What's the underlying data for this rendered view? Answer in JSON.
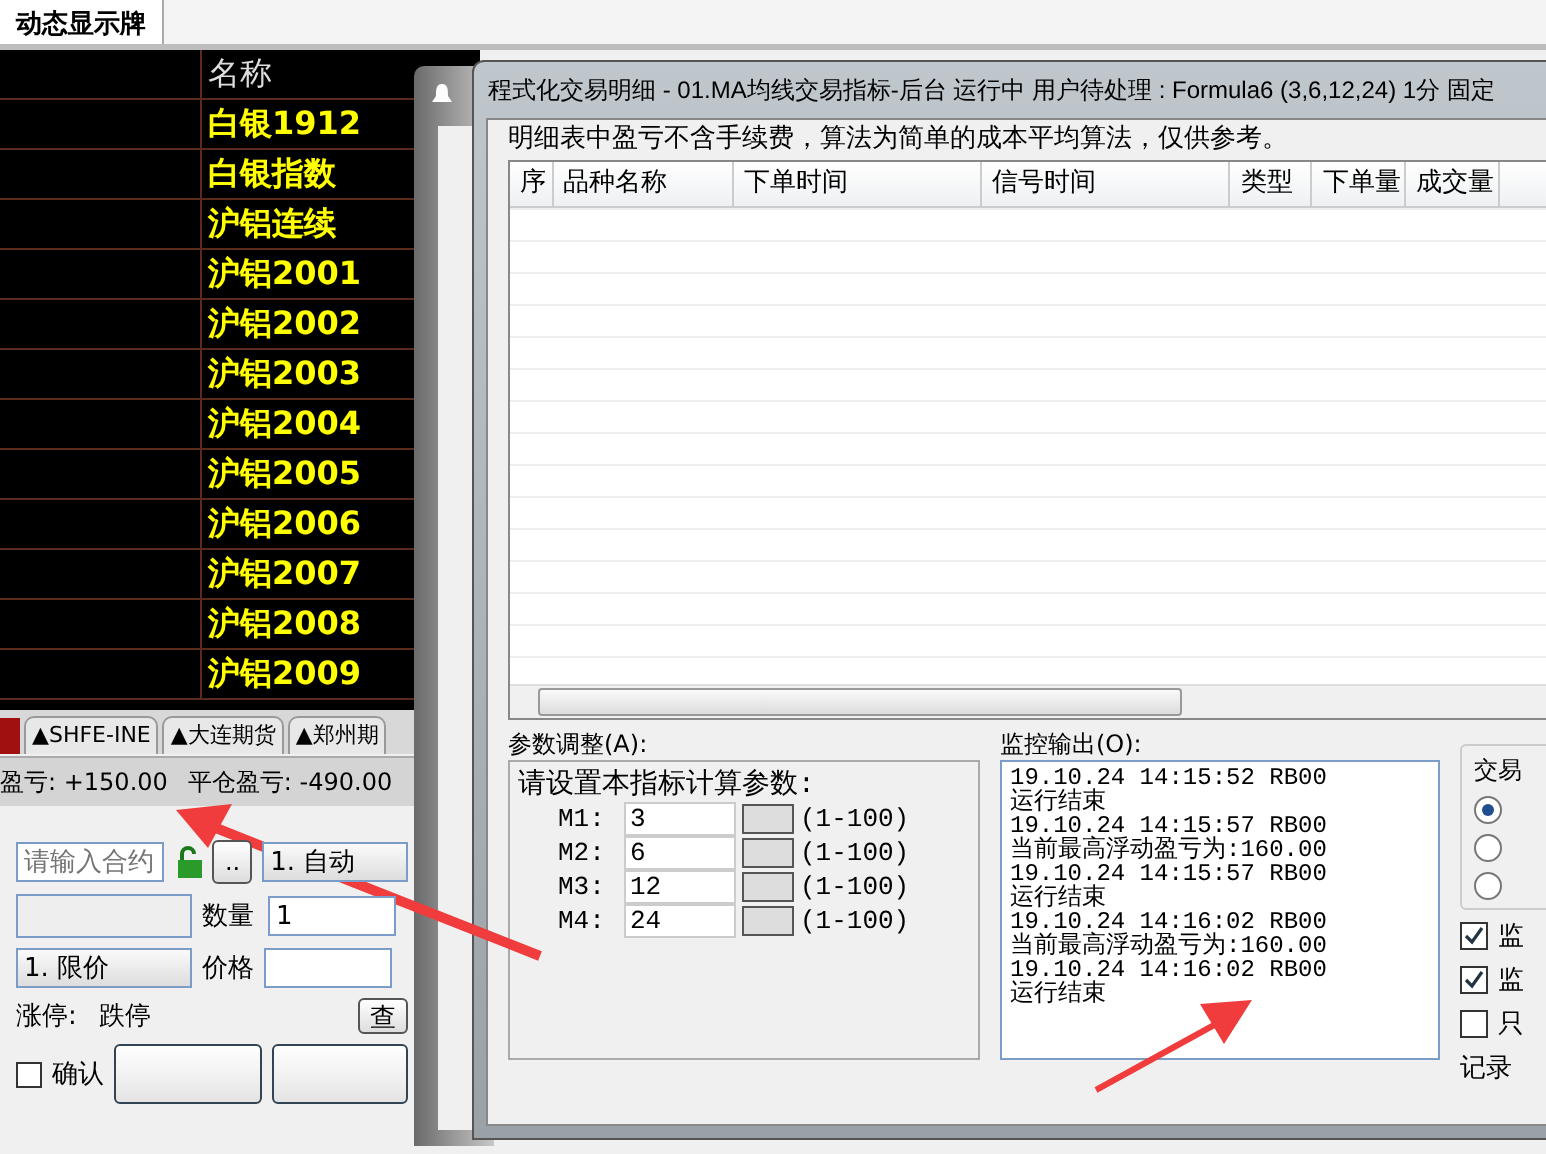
{
  "top_tab": {
    "label": "动态显示牌",
    "selected": true
  },
  "board": {
    "header": "名称",
    "rows": [
      "白银1912",
      "白银指数",
      "沪铝连续",
      "沪铝2001",
      "沪铝2002",
      "沪铝2003",
      "沪铝2004",
      "沪铝2005",
      "沪铝2006",
      "沪铝2007",
      "沪铝2008",
      "沪铝2009"
    ]
  },
  "exchange_tabs": [
    {
      "label": "▲SHFE-INE",
      "selected": false
    },
    {
      "label": "▲大连期货",
      "selected": false
    },
    {
      "label": "▲郑州期",
      "selected": false
    }
  ],
  "pnl": {
    "floating": "盈亏: +150.00",
    "closed": "平仓盈亏: -490.00"
  },
  "order": {
    "contract_placeholder": "请输入合约",
    "more_button": "..",
    "mode": "1. 自动",
    "quantity_label": "数量",
    "quantity": "1",
    "order_type": "1. 限价",
    "price_label": "价格",
    "limit_up_label": "涨停:",
    "limit_down_label": "跌停",
    "query_button": "查",
    "confirm": {
      "label": "确认",
      "checked": false
    }
  },
  "dialog": {
    "title": "程式化交易明细 - 01.MA均线交易指标-后台 运行中  用户待处理 : Formula6 (3,6,12,24) 1分 固定",
    "note": "明细表中盈亏不含手续费，算法为简单的成本平均算法，仅供参考。",
    "columns": [
      "序",
      "品种名称",
      "下单时间",
      "信号时间",
      "类型",
      "下单量",
      "成交量"
    ],
    "params": {
      "label": "参数调整(A):",
      "heading": "请设置本指标计算参数:",
      "items": [
        {
          "name": "M1:",
          "value": "3",
          "range": "(1-100)"
        },
        {
          "name": "M2:",
          "value": "6",
          "range": "(1-100)"
        },
        {
          "name": "M3:",
          "value": "12",
          "range": "(1-100)"
        },
        {
          "name": "M4:",
          "value": "24",
          "range": "(1-100)"
        }
      ]
    },
    "monitor": {
      "label": "监控输出(O):",
      "lines": [
        "19.10.24 14:15:52 RB00",
        "运行结束",
        "19.10.24 14:15:57 RB00",
        "当前最高浮动盈亏为:160.00",
        "19.10.24 14:15:57 RB00",
        "运行结束",
        "19.10.24 14:16:02 RB00",
        "当前最高浮动盈亏为:160.00",
        "19.10.24 14:16:02 RB00",
        "运行结束"
      ]
    },
    "trade_group": {
      "label": "交易",
      "options": [
        {
          "selected": true
        },
        {
          "selected": false
        },
        {
          "selected": false
        }
      ]
    },
    "checks": [
      {
        "label": "监",
        "checked": true
      },
      {
        "label": "监",
        "checked": true
      },
      {
        "label": "只",
        "checked": false
      }
    ],
    "record_label": "记录"
  }
}
